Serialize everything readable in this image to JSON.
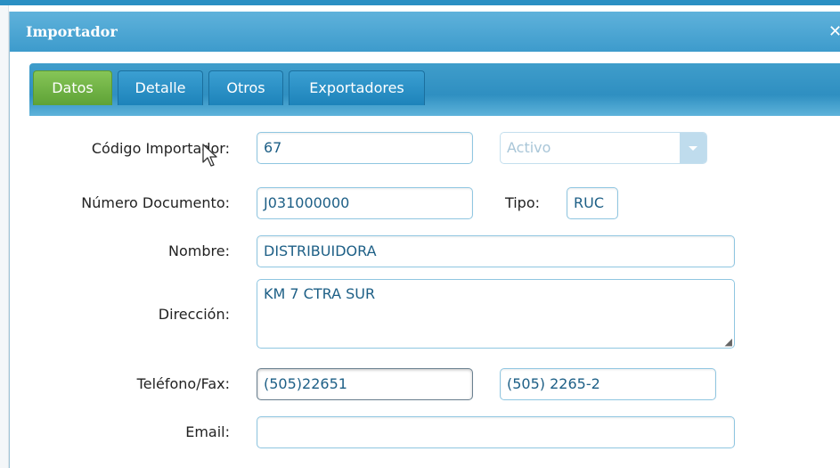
{
  "dialog": {
    "title": "Importador"
  },
  "tabs": [
    "Datos",
    "Detalle",
    "Otros",
    "Exportadores"
  ],
  "form": {
    "codigo_label": "Código Importador:",
    "codigo_value": "67",
    "estado_value": "Activo",
    "numero_label": "Número Documento:",
    "numero_value": "J031000000",
    "tipo_label": "Tipo:",
    "tipo_value": "RUC",
    "nombre_label": "Nombre:",
    "nombre_value": "DISTRIBUIDORA",
    "direccion_label": "Dirección:",
    "direccion_value": "KM 7 CTRA SUR",
    "telefono_label": "Teléfono/Fax:",
    "telefono_value": "(505)22651",
    "fax_value": "(505) 2265-2",
    "email_label": "Email:",
    "email_value": ""
  },
  "colors": {
    "titlebar": "#3d9bcc",
    "active_tab": "#6aad3f",
    "tab": "#2a8fc3",
    "field_text": "#1d5f86"
  },
  "icons": [
    "close-icon",
    "chevron-down-icon",
    "resize-handle-icon",
    "mouse-cursor-icon"
  ]
}
